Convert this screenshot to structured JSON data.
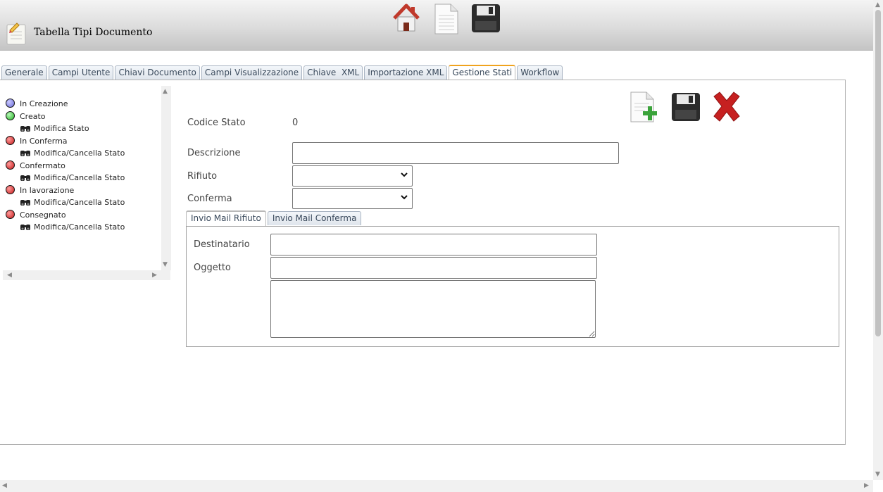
{
  "header": {
    "title": "Tabella Tipi Documento",
    "icons": [
      "document-edit-icon",
      "home-icon",
      "new-document-icon",
      "floppy-save-icon"
    ]
  },
  "tabs": [
    {
      "label": "Generale"
    },
    {
      "label": "Campi Utente"
    },
    {
      "label": "Chiavi Documento"
    },
    {
      "label": "Campi Visualizzazione"
    },
    {
      "label": "Chiave  XML"
    },
    {
      "label": "Importazione XML"
    },
    {
      "label": "Gestione Stati",
      "active": true
    },
    {
      "label": "Workflow"
    }
  ],
  "tree": {
    "nodes": [
      {
        "label": "In Creazione",
        "status_color": "#6b6bd9"
      },
      {
        "label": "Creato",
        "status_color": "#22b422",
        "child": "Modifica Stato"
      },
      {
        "label": "In Conferma",
        "status_color": "#c41a1a",
        "child": "Modifica/Cancella Stato"
      },
      {
        "label": "Confermato",
        "status_color": "#c41a1a",
        "child": "Modifica/Cancella Stato"
      },
      {
        "label": "In lavorazione",
        "status_color": "#c41a1a",
        "child": "Modifica/Cancella Stato"
      },
      {
        "label": "Consegnato",
        "status_color": "#c41a1a",
        "child": "Modifica/Cancella Stato"
      }
    ]
  },
  "form": {
    "codice_label": "Codice Stato",
    "codice_value": "0",
    "descrizione_label": "Descrizione",
    "descrizione_value": "",
    "rifiuto_label": "Rifiuto",
    "rifiuto_value": "",
    "conferma_label": "Conferma",
    "conferma_value": ""
  },
  "actions": [
    "add-document-icon",
    "floppy-save-icon",
    "delete-x-icon"
  ],
  "subtabs": [
    {
      "label": "Invio Mail Rifiuto",
      "active": true
    },
    {
      "label": "Invio Mail Conferma"
    }
  ],
  "mail": {
    "destinatario_label": "Destinatario",
    "destinatario_value": "",
    "oggetto_label": "Oggetto",
    "oggetto_value": "",
    "body_value": ""
  },
  "colors": {
    "accent_tab": "#f0a31e",
    "tab_text": "#3a4a5c"
  }
}
